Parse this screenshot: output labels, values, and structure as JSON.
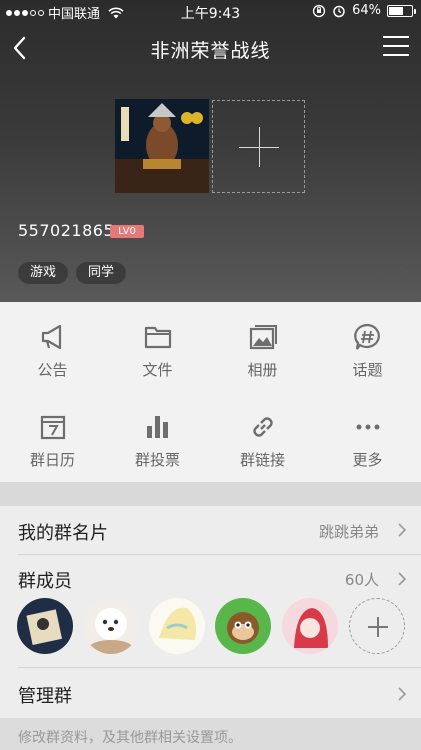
{
  "status_bar": {
    "carrier": "中国联通",
    "time": "上午9:43",
    "battery": "64%",
    "battery_level": 0.64
  },
  "nav": {
    "title": "非洲荣誉战线",
    "back_icon": "chevron-left-icon",
    "menu_icon": "hamburger-menu-icon"
  },
  "group": {
    "id": "557021865",
    "level": "LV0",
    "tags": [
      "游戏",
      "同学"
    ]
  },
  "actions": [
    {
      "label": "公告",
      "icon": "megaphone-icon"
    },
    {
      "label": "文件",
      "icon": "folder-icon"
    },
    {
      "label": "相册",
      "icon": "photo-album-icon"
    },
    {
      "label": "话题",
      "icon": "hashtag-bubble-icon"
    },
    {
      "label": "群日历",
      "icon": "calendar-icon"
    },
    {
      "label": "群投票",
      "icon": "bar-chart-icon"
    },
    {
      "label": "群链接",
      "icon": "link-icon"
    },
    {
      "label": "更多",
      "icon": "more-dots-icon"
    }
  ],
  "rows": {
    "card": {
      "label": "我的群名片",
      "value": "跳跳弟弟"
    },
    "members": {
      "label": "群成员",
      "value": "60人"
    },
    "manage": {
      "label": "管理群"
    }
  },
  "footer": {
    "text": "修改群资料，及其他群相关设置项。"
  },
  "colors": {
    "header_dark": "#2c2c2c",
    "badge": "#e6787a",
    "grid_bg": "#f2f2f2",
    "icon_gray": "#6e6e6e"
  }
}
